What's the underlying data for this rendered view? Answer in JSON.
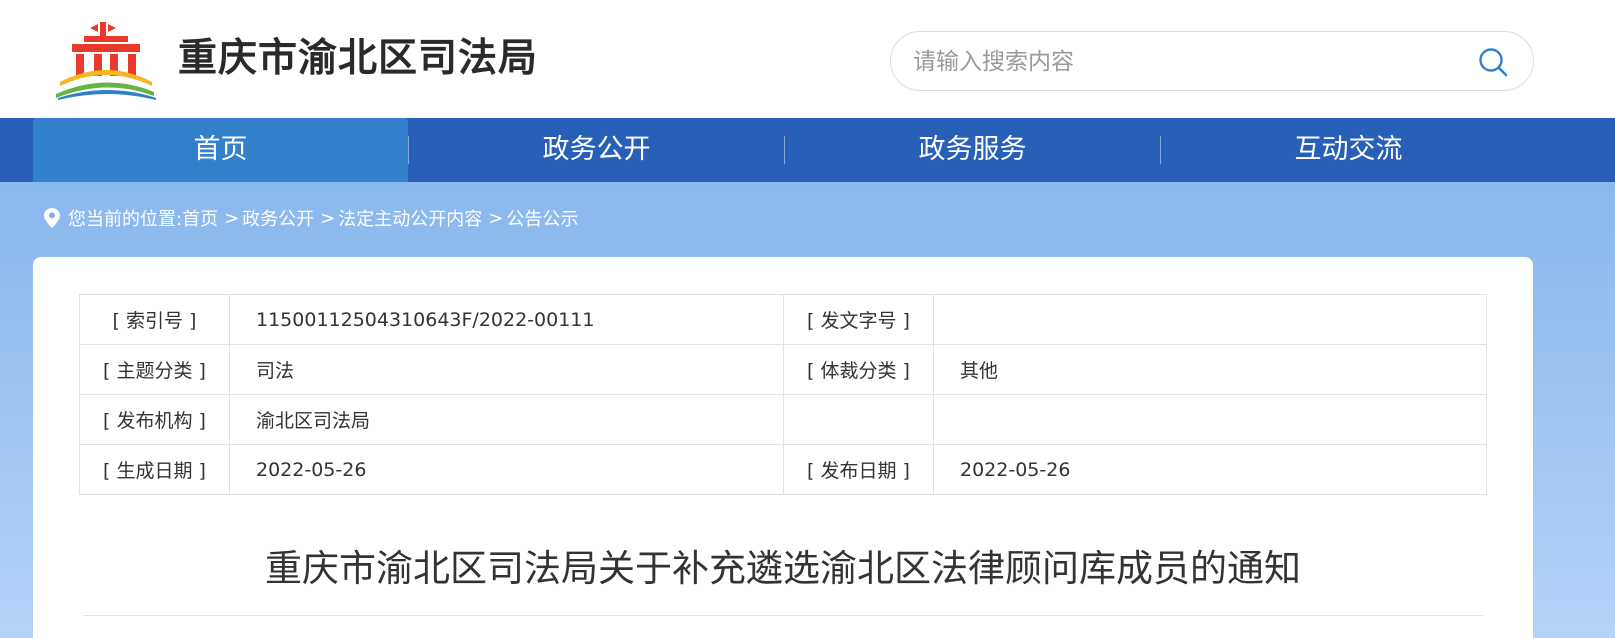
{
  "header": {
    "site_title": "重庆市渝北区司法局",
    "search_placeholder": "请输入搜索内容"
  },
  "nav": {
    "items": [
      {
        "label": "首页"
      },
      {
        "label": "政务公开"
      },
      {
        "label": "政务服务"
      },
      {
        "label": "互动交流"
      }
    ]
  },
  "breadcrumb": {
    "prefix": "您当前的位置:",
    "items": [
      "首页",
      "政务公开",
      "法定主动公开内容",
      "公告公示"
    ],
    "separator": ">"
  },
  "meta": {
    "index_label": "[ 索引号 ]",
    "index_value": "11500112504310643F/2022-00111",
    "doc_no_label": "[ 发文字号 ]",
    "doc_no_value": "",
    "topic_label": "[ 主题分类 ]",
    "topic_value": "司法",
    "genre_label": "[ 体裁分类 ]",
    "genre_value": "其他",
    "publisher_label": "[ 发布机构 ]",
    "publisher_value": "渝北区司法局",
    "created_label": "[ 生成日期 ]",
    "created_value": "2022-05-26",
    "published_label": "[ 发布日期 ]",
    "published_value": "2022-05-26"
  },
  "article": {
    "title": "重庆市渝北区司法局关于补充遴选渝北区法律顾问库成员的通知"
  },
  "colors": {
    "nav_bg": "#2860b8",
    "nav_active": "#3380cb",
    "page_bg": "#8fbcef"
  }
}
